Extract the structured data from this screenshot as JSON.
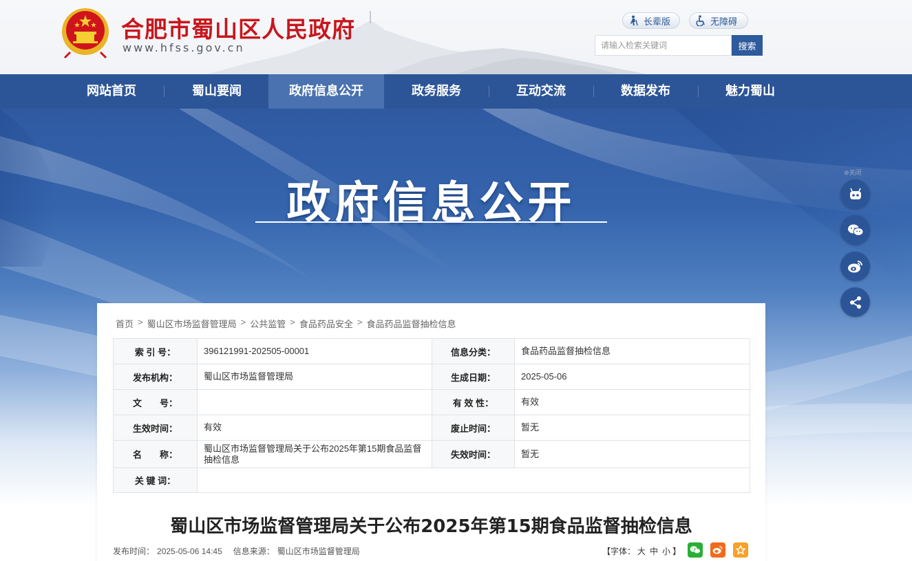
{
  "header": {
    "site_name": "合肥市蜀山区人民政府",
    "site_url": "www.hfss.gov.cn",
    "elder_mode": "长辈版",
    "accessibility": "无障碍",
    "search_placeholder": "请输入检索关键词",
    "search_button": "搜索"
  },
  "nav": {
    "items": [
      "网站首页",
      "蜀山要闻",
      "政府信息公开",
      "政务服务",
      "互动交流",
      "数据发布",
      "魅力蜀山"
    ],
    "active": "政府信息公开"
  },
  "banner": {
    "title": "政府信息公开"
  },
  "side": {
    "close_label": "⊗关闭",
    "icons": [
      "robot-icon",
      "wechat-icon",
      "weibo-icon",
      "share-icon"
    ]
  },
  "breadcrumb": [
    "首页",
    "蜀山区市场监督管理局",
    "公共监管",
    "食品药品安全",
    "食品药品监督抽检信息"
  ],
  "meta": {
    "index_no_label": "索 引 号：",
    "index_no": "396121991-202505-00001",
    "category_label": "信息分类：",
    "category": "食品药品监督抽检信息",
    "publisher_label": "发布机构：",
    "publisher": "蜀山区市场监督管理局",
    "created_label": "生成日期：",
    "created": "2025-05-06",
    "doc_no_label": "文　　号：",
    "doc_no": "",
    "validity_label": "有 效 性：",
    "validity": "有效",
    "effective_label": "生效时间：",
    "effective": "有效",
    "repeal_label": "废止时间：",
    "repeal": "暂无",
    "name_label": "名　　称：",
    "name": "蜀山区市场监督管理局关于公布2025年第15期食品监督抽检信息",
    "expire_label": "失效时间：",
    "expire": "暂无",
    "keywords_label": "关 键 词：",
    "keywords": ""
  },
  "article": {
    "title": "蜀山区市场监督管理局关于公布2025年第15期食品监督抽检信息",
    "publish_label": "发布时间：",
    "publish_time": "2025-05-06 14:45",
    "source_label": "信息来源：",
    "source": "蜀山区市场监督管理局",
    "font_label": "【字体：",
    "font_large": "大",
    "font_medium": "中",
    "font_small": "小",
    "font_close": "】"
  },
  "colors": {
    "brand_red": "#c8161d",
    "nav_blue": "#2c5597",
    "nav_active": "#4a72b0",
    "wechat_green": "#2aae36",
    "weibo_orange": "#f26a1b",
    "fav_orange": "#f7a128"
  }
}
